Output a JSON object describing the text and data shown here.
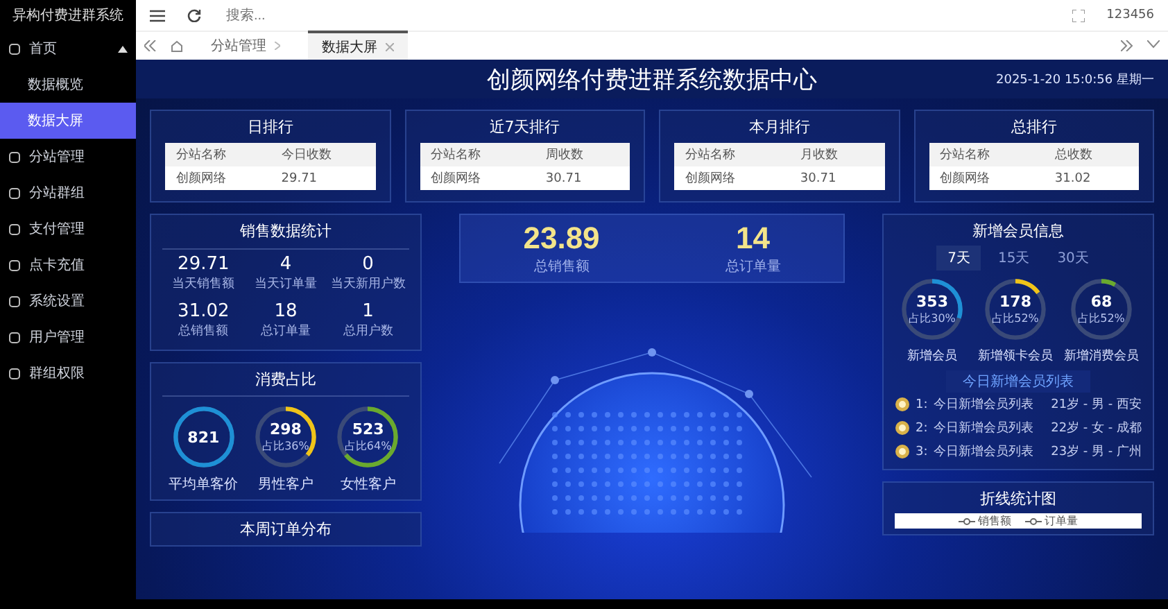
{
  "sidebar": {
    "title": "异构付费进群系统",
    "items": [
      {
        "label": "首页",
        "expanded": true,
        "selected": false,
        "children": [
          {
            "label": "数据概览",
            "selected": false
          },
          {
            "label": "数据大屏",
            "selected": true
          }
        ]
      },
      {
        "label": "分站管理",
        "selected": false
      },
      {
        "label": "分站群组",
        "selected": false
      },
      {
        "label": "支付管理",
        "selected": false
      },
      {
        "label": "点卡充值",
        "selected": false
      },
      {
        "label": "系统设置",
        "selected": false
      },
      {
        "label": "用户管理",
        "selected": false
      },
      {
        "label": "群组权限",
        "selected": false
      }
    ]
  },
  "header": {
    "search": {
      "placeholder": "搜索..."
    },
    "user": "123456"
  },
  "tabs": [
    {
      "label": "分站管理",
      "selected": false
    },
    {
      "label": "数据大屏",
      "selected": true
    }
  ],
  "dashboard": {
    "title": "创颜网络付费进群系统数据中心",
    "datetime": "2025-1-20 15:0:56 星期一",
    "rankings": [
      {
        "title": "日排行",
        "columns": [
          "分站名称",
          "今日收数"
        ],
        "rows": [
          [
            "创颜网络",
            "29.71"
          ]
        ]
      },
      {
        "title": "近7天排行",
        "columns": [
          "分站名称",
          "周收数"
        ],
        "rows": [
          [
            "创颜网络",
            "30.71"
          ]
        ]
      },
      {
        "title": "本月排行",
        "columns": [
          "分站名称",
          "月收数"
        ],
        "rows": [
          [
            "创颜网络",
            "30.71"
          ]
        ]
      },
      {
        "title": "总排行",
        "columns": [
          "分站名称",
          "总收数"
        ],
        "rows": [
          [
            "创颜网络",
            "31.02"
          ]
        ]
      }
    ],
    "sales": {
      "title": "销售数据统计",
      "stats": [
        {
          "value": "29.71",
          "label": "当天销售额"
        },
        {
          "value": "4",
          "label": "当天订单量"
        },
        {
          "value": "0",
          "label": "当天新用户数"
        },
        {
          "value": "31.02",
          "label": "总销售额"
        },
        {
          "value": "18",
          "label": "总订单量"
        },
        {
          "value": "1",
          "label": "总用户数"
        }
      ]
    },
    "consumption": {
      "title": "消费占比",
      "rings": [
        {
          "value": "821",
          "label": "平均单客价",
          "level": 1,
          "color": "#1e90d6"
        },
        {
          "value": "298",
          "share": "占比36%",
          "label": "男性客户",
          "level": 0.36,
          "color": "#f0c419"
        },
        {
          "value": "523",
          "share": "占比64%",
          "label": "女性客户",
          "level": 0.64,
          "color": "#6aaa2e"
        }
      ]
    },
    "orders_card": {
      "title": "本周订单分布"
    },
    "totals": [
      {
        "value": "23.89",
        "label": "总销售额"
      },
      {
        "value": "14",
        "label": "总订单量"
      }
    ],
    "members": {
      "title": "新增会员信息",
      "periods": [
        {
          "label": "7天",
          "selected": true
        },
        {
          "label": "15天",
          "selected": false
        },
        {
          "label": "30天",
          "selected": false
        }
      ],
      "rings": [
        {
          "value": "353",
          "share": "占比30%",
          "label": "新增会员",
          "level": 0.3,
          "color": "#1e90d6"
        },
        {
          "value": "178",
          "share": "占比52%",
          "label": "新增领卡会员",
          "level": 0.15,
          "color": "#f0c419"
        },
        {
          "value": "68",
          "share": "占比52%",
          "label": "新增消费会员",
          "level": 0.08,
          "color": "#6aaa2e"
        }
      ],
      "list_title": "今日新增会员列表",
      "list": [
        {
          "index": "1:",
          "name": "今日新增会员列表",
          "info": "21岁 - 男 - 西安"
        },
        {
          "index": "2:",
          "name": "今日新增会员列表",
          "info": "22岁 - 女 - 成都"
        },
        {
          "index": "3:",
          "name": "今日新增会员列表",
          "info": "23岁 - 男 - 广州"
        }
      ]
    },
    "line_card": {
      "title": "折线统计图",
      "legend": [
        "销售额",
        "订单量"
      ]
    }
  }
}
